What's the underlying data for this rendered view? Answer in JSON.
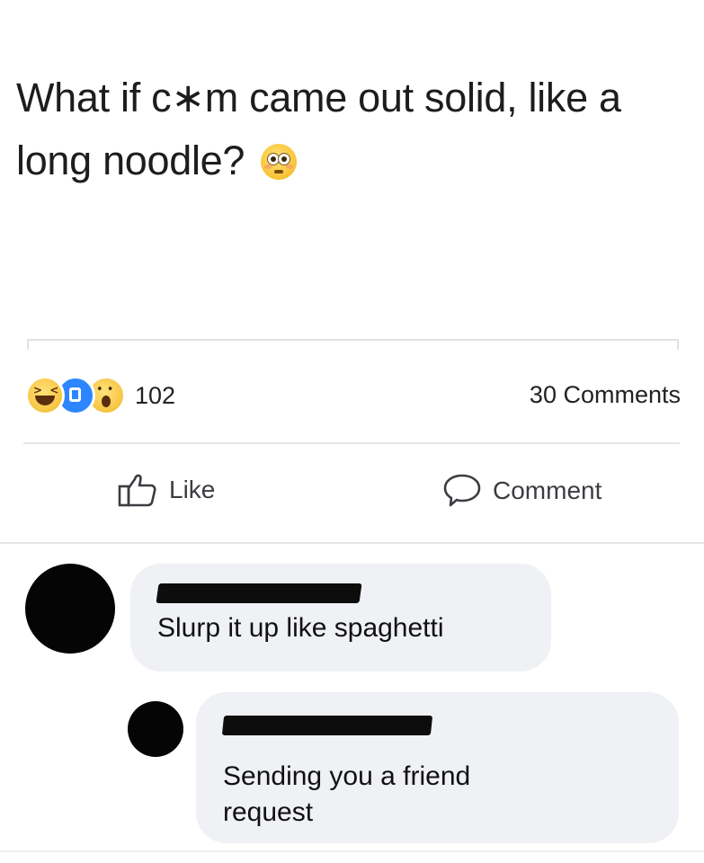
{
  "post": {
    "text": "What if c∗m came out solid, like a long noodle?",
    "emoji": "flushed-face-icon"
  },
  "reactions": {
    "icons": [
      "haha-reaction-icon",
      "like-reaction-icon",
      "wow-reaction-icon"
    ],
    "count": "102",
    "comments_count": "30 Comments"
  },
  "actions": {
    "like_label": "Like",
    "comment_label": "Comment"
  },
  "comments": [
    {
      "author": "[redacted]",
      "text": "Slurp it up like spaghetti"
    },
    {
      "author": "[redacted]",
      "text": "Sending you a friend request"
    }
  ],
  "colors": {
    "like_blue": "#2d86ff",
    "bubble_bg": "#eff1f4",
    "redaction": "#0d0d0d"
  }
}
